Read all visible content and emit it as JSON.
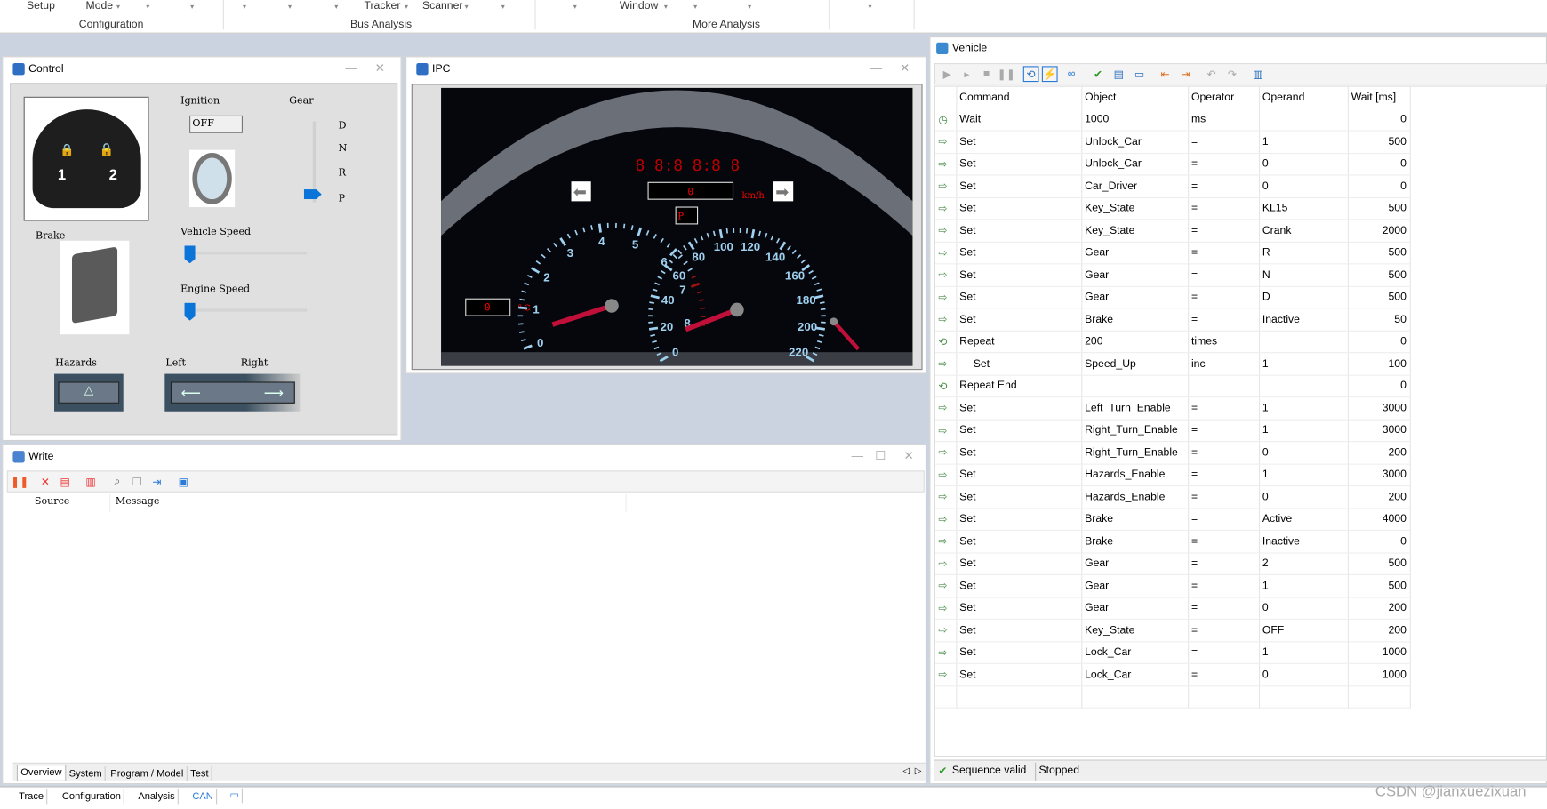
{
  "ribbon": {
    "items": [
      "Setup",
      "Mode",
      "Tracker",
      "Scanner",
      "Window"
    ],
    "groups": [
      "Configuration",
      "Bus Analysis",
      "More Analysis"
    ]
  },
  "control": {
    "title": "Control",
    "ignition_label": "Ignition",
    "ignition_value": "OFF",
    "gear_label": "Gear",
    "gears": [
      "D",
      "N",
      "R",
      "P"
    ],
    "gear_selected": "P",
    "brake_label": "Brake",
    "vehicle_speed_label": "Vehicle Speed",
    "vehicle_speed_value": 0,
    "engine_speed_label": "Engine Speed",
    "engine_speed_value": 0,
    "hazards_label": "Hazards",
    "left_label": "Left",
    "right_label": "Right",
    "key_buttons": [
      "1",
      "2"
    ]
  },
  "ipc": {
    "title": "IPC",
    "speed_value": "0",
    "speed_unit": "km/h",
    "gear": "P",
    "temp_value": "0",
    "temp_unit": "° C",
    "rpm_ticks": [
      "0",
      "1",
      "2",
      "3",
      "4",
      "5",
      "6",
      "7",
      "8"
    ],
    "speed_ticks": [
      "0",
      "20",
      "40",
      "60",
      "80",
      "100",
      "120",
      "140",
      "160",
      "180",
      "200",
      "220"
    ]
  },
  "write": {
    "title": "Write",
    "columns": [
      "Source",
      "Message"
    ],
    "tabs": [
      "Overview",
      "System",
      "Program / Model",
      "Test"
    ],
    "active_tab": "Overview"
  },
  "vehicle": {
    "title": "Vehicle",
    "columns": [
      "Command",
      "Object",
      "Operator",
      "Operand",
      "Wait [ms]"
    ],
    "rows": [
      {
        "icon": "clock-icon",
        "command": "Wait",
        "object": "1000",
        "operator": "ms",
        "operand": "",
        "wait": "0"
      },
      {
        "icon": "set-icon",
        "command": "Set",
        "object": "Unlock_Car",
        "operator": "=",
        "operand": "1",
        "wait": "500"
      },
      {
        "icon": "set-icon",
        "command": "Set",
        "object": "Unlock_Car",
        "operator": "=",
        "operand": "0",
        "wait": "0"
      },
      {
        "icon": "set-icon",
        "command": "Set",
        "object": "Car_Driver",
        "operator": "=",
        "operand": "0",
        "wait": "0"
      },
      {
        "icon": "set-icon",
        "command": "Set",
        "object": "Key_State",
        "operator": "=",
        "operand": "KL15",
        "wait": "500"
      },
      {
        "icon": "set-icon",
        "command": "Set",
        "object": "Key_State",
        "operator": "=",
        "operand": "Crank",
        "wait": "2000"
      },
      {
        "icon": "set-icon",
        "command": "Set",
        "object": "Gear",
        "operator": "=",
        "operand": "R",
        "wait": "500"
      },
      {
        "icon": "set-icon",
        "command": "Set",
        "object": "Gear",
        "operator": "=",
        "operand": "N",
        "wait": "500"
      },
      {
        "icon": "set-icon",
        "command": "Set",
        "object": "Gear",
        "operator": "=",
        "operand": "D",
        "wait": "500"
      },
      {
        "icon": "set-icon",
        "command": "Set",
        "object": "Brake",
        "operator": "=",
        "operand": "Inactive",
        "wait": "50"
      },
      {
        "icon": "repeat-icon",
        "command": "Repeat",
        "object": "200",
        "operator": "times",
        "operand": "",
        "wait": "0"
      },
      {
        "icon": "set-icon",
        "command": "Set",
        "object": "Speed_Up",
        "operator": "inc",
        "operand": "1",
        "wait": "100",
        "indent": true
      },
      {
        "icon": "repeat-icon",
        "command": "Repeat End",
        "object": "",
        "operator": "",
        "operand": "",
        "wait": "0"
      },
      {
        "icon": "set-icon",
        "command": "Set",
        "object": "Left_Turn_Enable",
        "operator": "=",
        "operand": "1",
        "wait": "3000"
      },
      {
        "icon": "set-icon",
        "command": "Set",
        "object": "Right_Turn_Enable",
        "operator": "=",
        "operand": "1",
        "wait": "3000"
      },
      {
        "icon": "set-icon",
        "command": "Set",
        "object": "Right_Turn_Enable",
        "operator": "=",
        "operand": "0",
        "wait": "200"
      },
      {
        "icon": "set-icon",
        "command": "Set",
        "object": "Hazards_Enable",
        "operator": "=",
        "operand": "1",
        "wait": "3000"
      },
      {
        "icon": "set-icon",
        "command": "Set",
        "object": "Hazards_Enable",
        "operator": "=",
        "operand": "0",
        "wait": "200"
      },
      {
        "icon": "set-icon",
        "command": "Set",
        "object": "Brake",
        "operator": "=",
        "operand": "Active",
        "wait": "4000"
      },
      {
        "icon": "set-icon",
        "command": "Set",
        "object": "Brake",
        "operator": "=",
        "operand": "Inactive",
        "wait": "0"
      },
      {
        "icon": "set-icon",
        "command": "Set",
        "object": "Gear",
        "operator": "=",
        "operand": "2",
        "wait": "500"
      },
      {
        "icon": "set-icon",
        "command": "Set",
        "object": "Gear",
        "operator": "=",
        "operand": "1",
        "wait": "500"
      },
      {
        "icon": "set-icon",
        "command": "Set",
        "object": "Gear",
        "operator": "=",
        "operand": "0",
        "wait": "200"
      },
      {
        "icon": "set-icon",
        "command": "Set",
        "object": "Key_State",
        "operator": "=",
        "operand": "OFF",
        "wait": "200"
      },
      {
        "icon": "set-icon",
        "command": "Set",
        "object": "Lock_Car",
        "operator": "=",
        "operand": "1",
        "wait": "1000"
      },
      {
        "icon": "set-icon",
        "command": "Set",
        "object": "Lock_Car",
        "operator": "=",
        "operand": "0",
        "wait": "1000"
      }
    ],
    "status": [
      "Sequence valid",
      "Stopped"
    ]
  },
  "bottom_tabs": [
    "Trace",
    "Configuration",
    "Analysis",
    "CAN"
  ],
  "watermark": "CSDN @jianxuezixuan"
}
